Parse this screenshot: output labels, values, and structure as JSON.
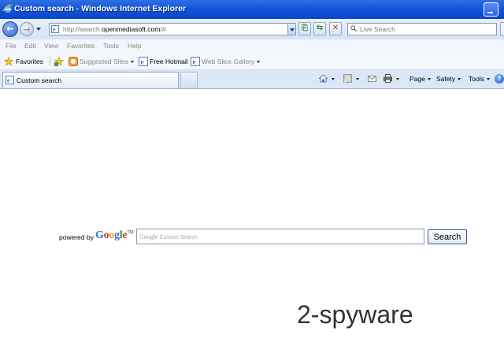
{
  "window": {
    "title": "Custom search - Windows Internet Explorer"
  },
  "address_bar": {
    "url_prefix": "http://search.",
    "url_domain": "openmediasoft.com",
    "url_suffix": "/#"
  },
  "search_box": {
    "placeholder": "Live Search"
  },
  "menu": {
    "items": [
      "File",
      "Edit",
      "View",
      "Favorites",
      "Tools",
      "Help"
    ]
  },
  "favorites_bar": {
    "favorites_label": "Favorites",
    "items": [
      "Suggested Sites",
      "Free Hotmail",
      "Web Slice Gallery"
    ]
  },
  "tabs": [
    {
      "label": "Custom search",
      "active": true
    }
  ],
  "command_bar": {
    "page_label": "Page",
    "safety_label": "Safety",
    "tools_label": "Tools"
  },
  "content": {
    "powered_by": "powered by",
    "google_letters": [
      "G",
      "o",
      "o",
      "g",
      "l",
      "e"
    ],
    "google_tm": "TM",
    "search_watermark_brand": "Google",
    "search_watermark_text": "Custom Search",
    "search_button": "Search",
    "watermark": "2-spyware"
  },
  "colors": {
    "titlebar": "#1255dd",
    "chrome_bg": "#dbe6f6"
  }
}
